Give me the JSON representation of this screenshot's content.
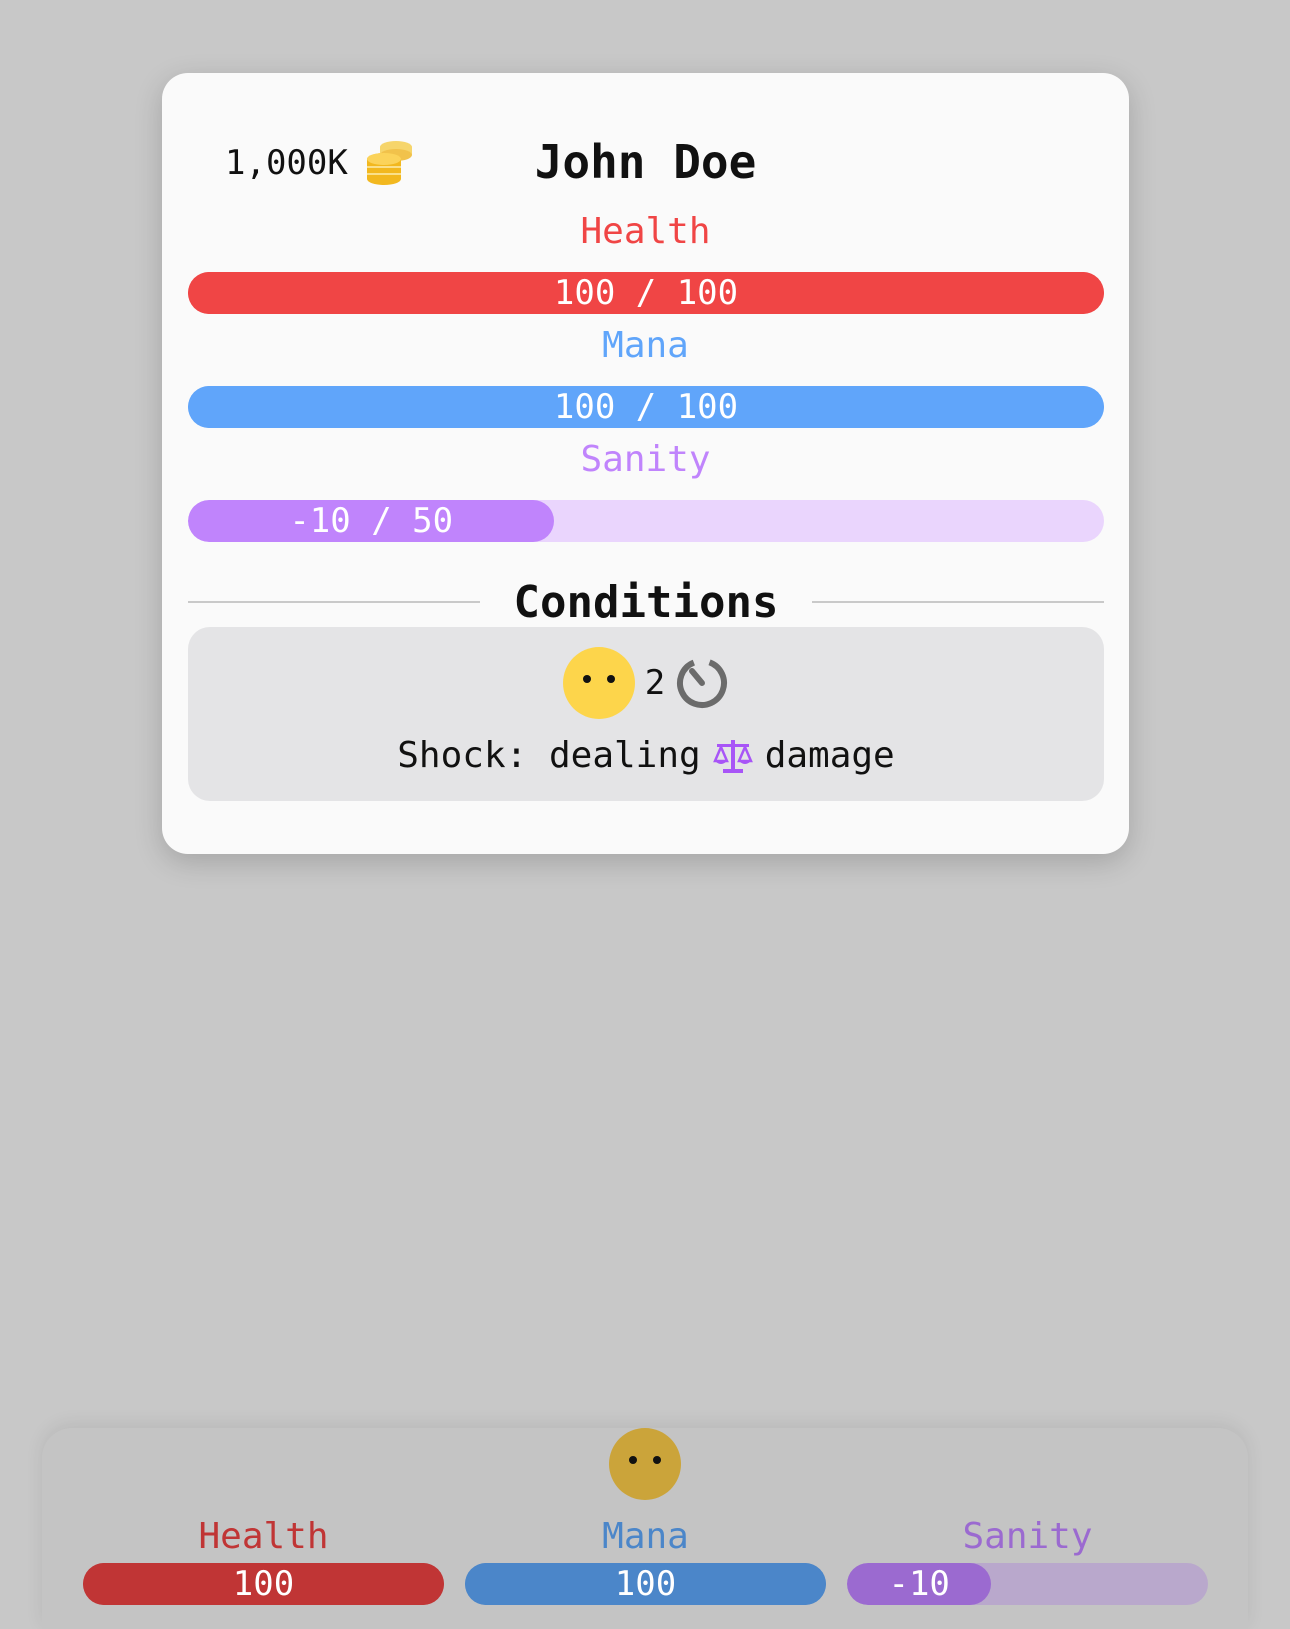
{
  "character": {
    "name": "John Doe",
    "gold": "1,000K",
    "gold_icon": "coin-stack-icon"
  },
  "stats": {
    "health": {
      "label": "Health",
      "text": "100 / 100",
      "fraction": 1.0,
      "color": "#f04545",
      "track": "#f04545"
    },
    "mana": {
      "label": "Mana",
      "text": "100 / 100",
      "fraction": 1.0,
      "color": "#60a5fa",
      "track": "#60a5fa"
    },
    "sanity": {
      "label": "Sanity",
      "text": "-10 / 50",
      "fraction": 0.4,
      "color": "#c084fc",
      "track": "#ead5fd"
    }
  },
  "conditions": {
    "title": "Conditions",
    "items": [
      {
        "icon": "yellow-face-icon",
        "turns": "2",
        "turns_icon": "timer-icon",
        "desc_prefix": "Shock: dealing",
        "desc_icon": "scale-icon",
        "desc_suffix": "damage"
      }
    ]
  },
  "mini_panel": {
    "health": {
      "label": "Health",
      "value": "100",
      "fraction": 1.0,
      "color": "#c03535",
      "label_color": "#c03535",
      "track": "#c03535"
    },
    "mana": {
      "label": "Mana",
      "value": "100",
      "fraction": 1.0,
      "color": "#4b86c9",
      "label_color": "#4b86c9",
      "track": "#4b86c9"
    },
    "sanity": {
      "label": "Sanity",
      "value": "-10",
      "fraction": 0.4,
      "color": "#9b6ad0",
      "label_color": "#9b6ad0",
      "track": "#b9a8cc"
    }
  }
}
